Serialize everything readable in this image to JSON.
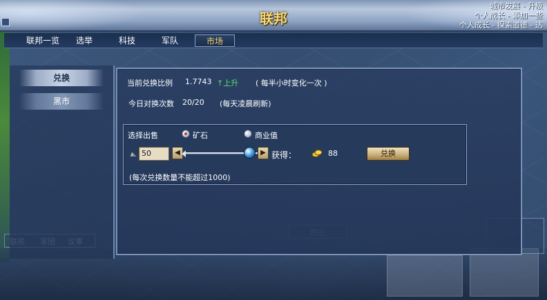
{
  "window": {
    "title": "联邦",
    "corner_lines": [
      "城市发展 - 升级",
      "个人成长 - 添加一些",
      "个人成长 - 探索道德 - 达"
    ]
  },
  "tabs": [
    {
      "label": "联邦一览",
      "active": false
    },
    {
      "label": "选举",
      "active": false
    },
    {
      "label": "科技",
      "active": false
    },
    {
      "label": "军队",
      "active": false
    },
    {
      "label": "市场",
      "active": true
    }
  ],
  "side_menu": [
    {
      "label": "兑换",
      "selected": true
    },
    {
      "label": "黑市",
      "selected": false
    }
  ],
  "market": {
    "rate_label": "当前兑换比例",
    "rate_value": "1.7743",
    "trend_label": "↑上升",
    "rate_note": "( 每半小时变化一次 )",
    "count_label": "今日对换次数",
    "count_value": "20/20",
    "count_note": "(每天凌晨刷新)"
  },
  "exchange": {
    "sell_label": "选择出售",
    "options": [
      {
        "label": "矿石",
        "selected": true
      },
      {
        "label": "商业值",
        "selected": false
      }
    ],
    "quantity": "50",
    "slider_fraction": 1.0,
    "gain_label": "获得：",
    "gain_value": "88",
    "button_label": "兑换",
    "note": "(每次兑换数量不能超过1000)"
  },
  "background": {
    "bottom_tabs": [
      "联邦",
      "军团",
      "议事"
    ],
    "center_button": "建造"
  },
  "colors": {
    "title_gold": "#f6d77a",
    "trend_green": "#58e06a",
    "active_tab_text": "#f5d06a"
  }
}
